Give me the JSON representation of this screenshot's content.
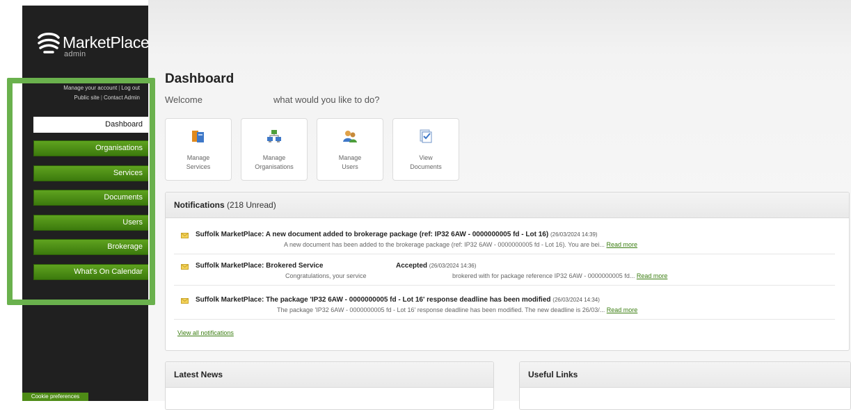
{
  "brand": {
    "name": "MarketPlace",
    "sub": "admin"
  },
  "account": {
    "manage": "Manage your account",
    "logout": "Log out",
    "public_site": "Public site",
    "contact": "Contact Admin",
    "sep": "|"
  },
  "nav": [
    {
      "label": "Dashboard",
      "active": true
    },
    {
      "label": "Organisations"
    },
    {
      "label": "Services"
    },
    {
      "label": "Documents"
    },
    {
      "label": "Users"
    },
    {
      "label": "Brokerage"
    },
    {
      "label": "What's On Calendar"
    }
  ],
  "cookie": "Cookie preferences",
  "dashboard": {
    "title": "Dashboard",
    "welcome": "Welcome",
    "question": "what would you like to do?"
  },
  "tiles": [
    {
      "line1": "Manage",
      "line2": "Services",
      "icon": "services-icon"
    },
    {
      "line1": "Manage",
      "line2": "Organisations",
      "icon": "organisations-icon"
    },
    {
      "line1": "Manage",
      "line2": "Users",
      "icon": "users-icon"
    },
    {
      "line1": "View",
      "line2": "Documents",
      "icon": "documents-icon"
    }
  ],
  "notifications": {
    "title": "Notifications",
    "count": "(218 Unread)",
    "read_more": "Read more",
    "view_all": "View all notifications",
    "items": [
      {
        "title": "Suffolk MarketPlace: A new document added to brokerage package (ref: IP32 6AW - 0000000005 fd - Lot 16)",
        "ts": "(26/03/2024 14:39)",
        "body": "A new document has been added to the brokerage package (ref: IP32 6AW - 0000000005 fd - Lot 16). You are bei..."
      },
      {
        "title": "Suffolk MarketPlace: Brokered Service",
        "status": "Accepted",
        "ts": "(26/03/2024 14:36)",
        "body": "Congratulations, your service",
        "body2": "brokered with for package reference IP32 6AW - 0000000005 fd..."
      },
      {
        "title": "Suffolk MarketPlace: The package 'IP32 6AW - 0000000005 fd - Lot 16' response deadline has been modified",
        "ts": "(26/03/2024 14:34)",
        "body": "The package 'IP32 6AW - 0000000005 fd - Lot 16' response deadline has been modified. The new deadline is 26/03/..."
      }
    ]
  },
  "latest_news": {
    "title": "Latest News"
  },
  "useful_links": {
    "title": "Useful Links"
  },
  "colors": {
    "green": "#4e8c16",
    "highlight": "#6ab14d",
    "sidebar": "#202020"
  }
}
